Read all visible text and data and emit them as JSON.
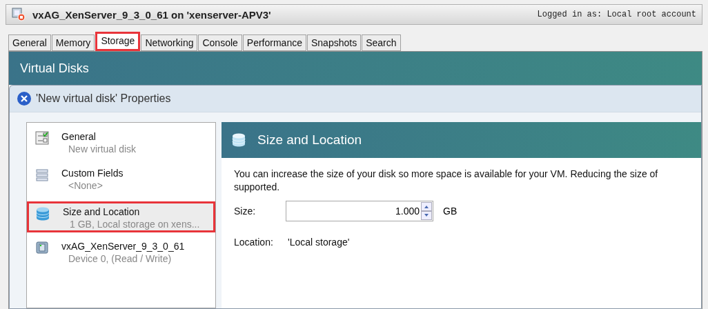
{
  "window": {
    "title": "vxAG_XenServer_9_3_0_61 on 'xenserver-APV3'",
    "login": "Logged in as: Local root account"
  },
  "tabs": [
    {
      "label": "General",
      "selected": false
    },
    {
      "label": "Memory",
      "selected": false
    },
    {
      "label": "Storage",
      "selected": true
    },
    {
      "label": "Networking",
      "selected": false
    },
    {
      "label": "Console",
      "selected": false
    },
    {
      "label": "Performance",
      "selected": false
    },
    {
      "label": "Snapshots",
      "selected": false
    },
    {
      "label": "Search",
      "selected": false
    }
  ],
  "section": {
    "title": "Virtual Disks"
  },
  "dialog": {
    "title": "'New virtual disk' Properties",
    "nav": [
      {
        "kind": "general",
        "label": "General",
        "sublabel": "New virtual disk",
        "selected": false
      },
      {
        "kind": "fields",
        "label": "Custom Fields",
        "sublabel": "<None>",
        "selected": false
      },
      {
        "kind": "disk",
        "label": "Size and Location",
        "sublabel": "1 GB, Local storage on xens...",
        "selected": true
      },
      {
        "kind": "vm",
        "label": "vxAG_XenServer_9_3_0_61",
        "sublabel": "Device 0, (Read / Write)",
        "selected": false
      }
    ],
    "page": {
      "title": "Size and Location",
      "description_lines": [
        "You can increase the size of your disk so more space is available for your VM. Reducing the size of",
        "supported."
      ],
      "size_label": "Size:",
      "size_value": "1.000",
      "size_unit": "GB",
      "location_label": "Location:",
      "location_value": "'Local storage'"
    }
  }
}
